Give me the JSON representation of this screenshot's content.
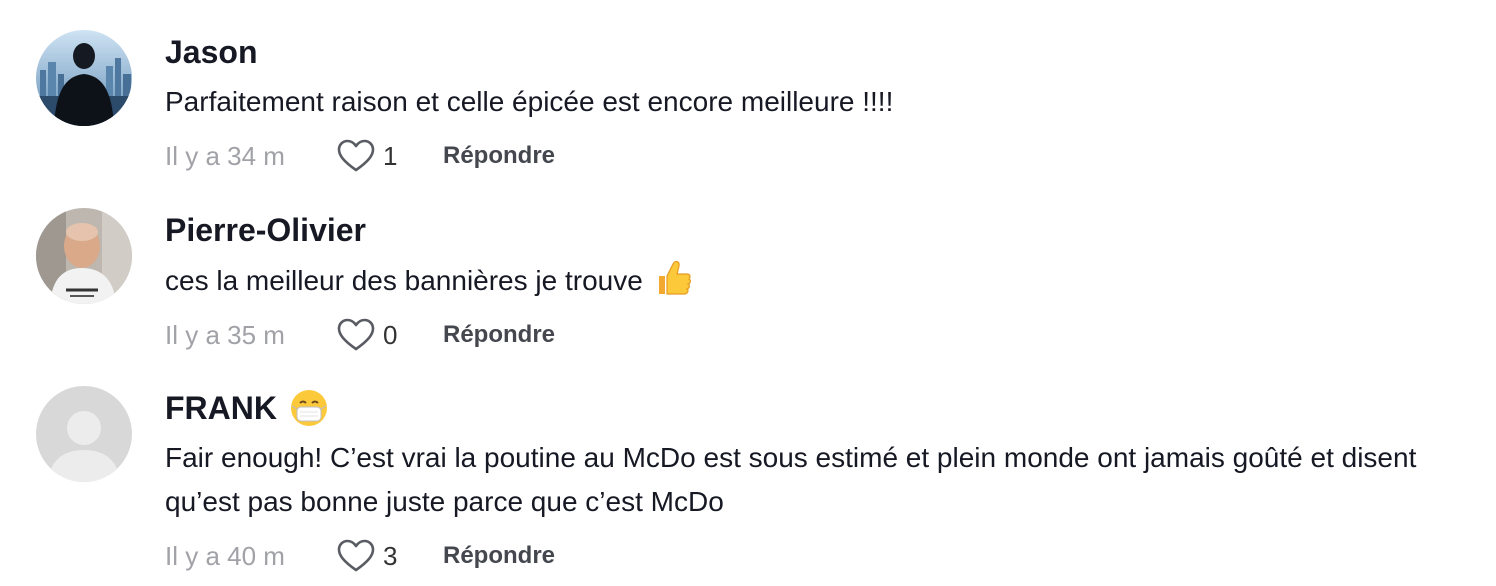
{
  "comments": [
    {
      "username": "Jason",
      "text": "Parfaitement raison et celle épicée est encore meilleure !!!!",
      "time": "Il y a 34 m",
      "likes": "1",
      "reply_label": "Répondre",
      "avatar": "city-skyline-person"
    },
    {
      "username": "Pierre-Olivier",
      "text": "ces la meilleur des bannières je trouve",
      "text_emoji": "thumbs-up",
      "time": "Il y a 35 m",
      "likes": "0",
      "reply_label": "Répondre",
      "avatar": "man-photo"
    },
    {
      "username": "FRANK",
      "username_emoji": "face-with-medical-mask",
      "text": "Fair enough! C’est vrai la poutine au McDo est sous estimé et plein monde ont jamais goûté et disent qu’est pas bonne juste parce que c’est McDo",
      "time": "Il y a 40 m",
      "likes": "3",
      "reply_label": "Répondre",
      "avatar": "default-avatar"
    }
  ],
  "colors": {
    "username": "#161823",
    "text": "#161823",
    "timestamp": "#a1a2a7",
    "reply": "#45474f",
    "default_avatar_bg": "#d8d8d8"
  }
}
